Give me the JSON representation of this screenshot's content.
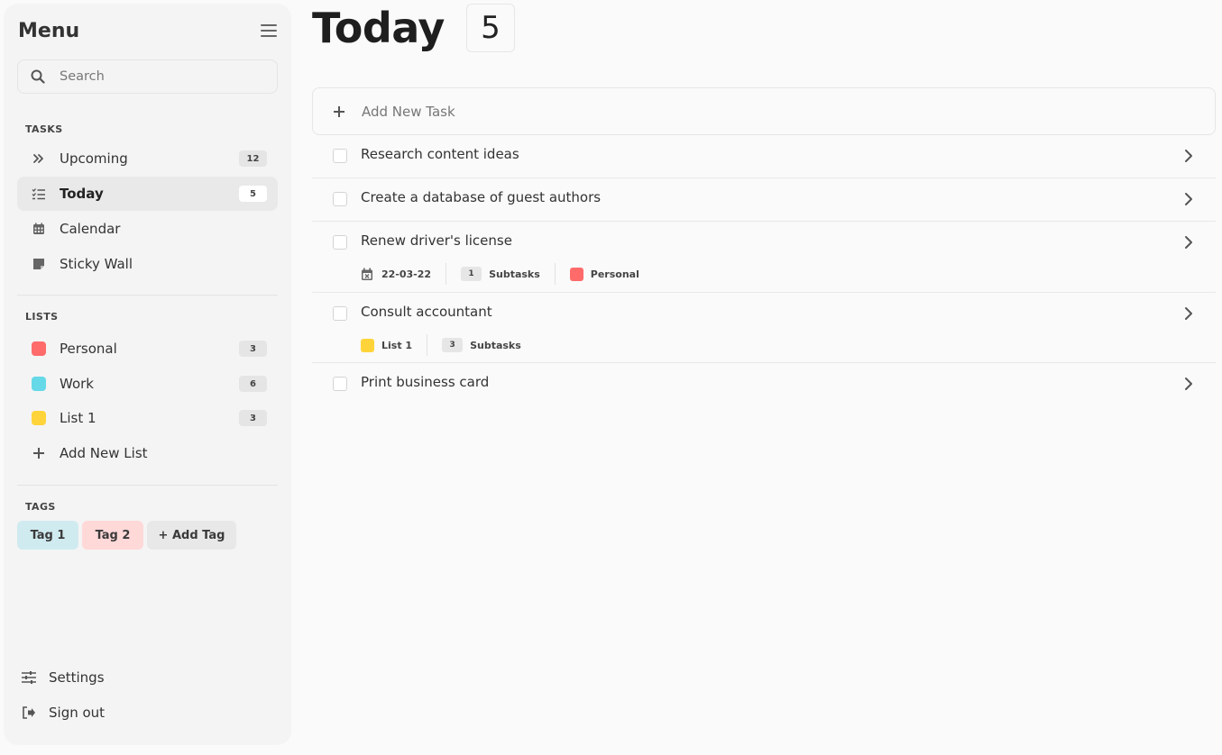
{
  "sidebar": {
    "title": "Menu",
    "search": {
      "placeholder": "Search",
      "value": ""
    },
    "tasks_section": {
      "label": "TASKS",
      "items": [
        {
          "label": "Upcoming",
          "count": "12",
          "icon": "double-chevron-icon"
        },
        {
          "label": "Today",
          "count": "5",
          "icon": "checklist-icon",
          "active": true
        },
        {
          "label": "Calendar",
          "icon": "calendar-icon"
        },
        {
          "label": "Sticky Wall",
          "icon": "sticky-note-icon"
        }
      ]
    },
    "lists_section": {
      "label": "LISTS",
      "items": [
        {
          "label": "Personal",
          "count": "3",
          "color": "#ff6b6b"
        },
        {
          "label": "Work",
          "count": "6",
          "color": "#66d9e8"
        },
        {
          "label": "List 1",
          "count": "3",
          "color": "#ffd43b"
        }
      ],
      "add_label": "Add New List"
    },
    "tags_section": {
      "label": "TAGS",
      "tags": [
        {
          "label": "Tag 1",
          "color": "#d0ebf0"
        },
        {
          "label": "Tag 2",
          "color": "#ffd8d8"
        }
      ],
      "add_label": "+ Add Tag"
    },
    "footer": {
      "settings_label": "Settings",
      "signout_label": "Sign out"
    }
  },
  "main": {
    "title": "Today",
    "count": "5",
    "add_task_label": "Add New Task",
    "tasks": [
      {
        "title": "Research content ideas"
      },
      {
        "title": "Create a database of guest authors"
      },
      {
        "title": "Renew driver's license",
        "date": "22-03-22",
        "subtasks_count": "1",
        "subtasks_label": "Subtasks",
        "list": "Personal",
        "list_color": "#ff6b6b"
      },
      {
        "title": "Consult accountant",
        "list": "List 1",
        "list_color": "#ffd43b",
        "subtasks_count": "3",
        "subtasks_label": "Subtasks"
      },
      {
        "title": "Print business card"
      }
    ]
  }
}
